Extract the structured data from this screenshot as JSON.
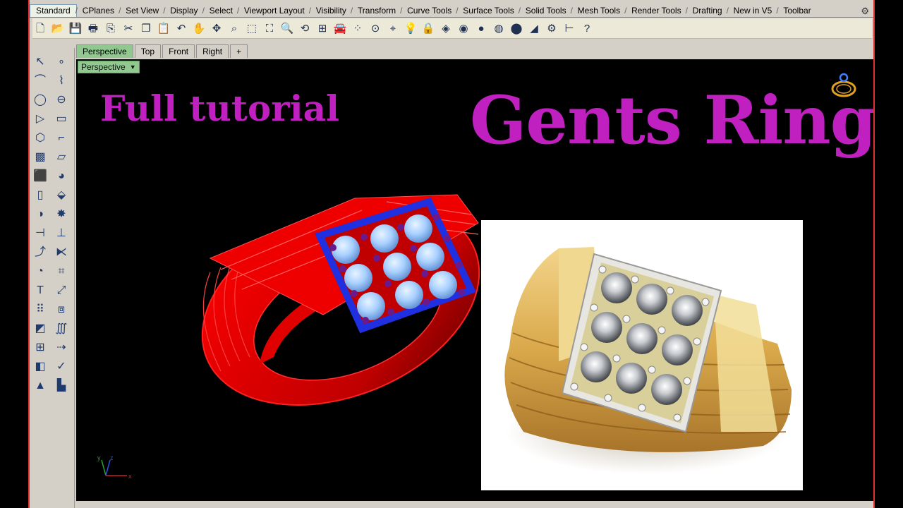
{
  "toolbar_tabs": [
    "Standard",
    "CPlanes",
    "Set View",
    "Display",
    "Select",
    "Viewport Layout",
    "Visibility",
    "Transform",
    "Curve Tools",
    "Surface Tools",
    "Solid Tools",
    "Mesh Tools",
    "Render Tools",
    "Drafting",
    "New in V5",
    "Toolbar"
  ],
  "active_toolbar_tab": "Standard",
  "settings_glyph": "⚙",
  "toolbar_icons": [
    {
      "name": "new-icon",
      "glyph": "🗋"
    },
    {
      "name": "open-icon",
      "glyph": "📂"
    },
    {
      "name": "save-icon",
      "glyph": "💾"
    },
    {
      "name": "print-icon",
      "glyph": "🖶"
    },
    {
      "name": "import-icon",
      "glyph": "⎘"
    },
    {
      "name": "cut-icon",
      "glyph": "✂"
    },
    {
      "name": "copy-icon",
      "glyph": "❐"
    },
    {
      "name": "paste-icon",
      "glyph": "📋"
    },
    {
      "name": "undo-icon",
      "glyph": "↶"
    },
    {
      "name": "pan-icon",
      "glyph": "✋"
    },
    {
      "name": "rotate-view-icon",
      "glyph": "✥"
    },
    {
      "name": "zoom-icon",
      "glyph": "⌕"
    },
    {
      "name": "zoom-window-icon",
      "glyph": "⬚"
    },
    {
      "name": "zoom-extents-icon",
      "glyph": "⛶"
    },
    {
      "name": "zoom-selected-icon",
      "glyph": "🔍"
    },
    {
      "name": "undo-view-icon",
      "glyph": "⟲"
    },
    {
      "name": "four-viewports-icon",
      "glyph": "⊞"
    },
    {
      "name": "car-icon",
      "glyph": "🚘"
    },
    {
      "name": "pointcloud-icon",
      "glyph": "⁘"
    },
    {
      "name": "grid-snap-icon",
      "glyph": "⊙"
    },
    {
      "name": "osnap-icon",
      "glyph": "⌖"
    },
    {
      "name": "light-icon",
      "glyph": "💡"
    },
    {
      "name": "lock-icon",
      "glyph": "🔒"
    },
    {
      "name": "layer-icon",
      "glyph": "◈"
    },
    {
      "name": "color-wheel-icon",
      "glyph": "◉"
    },
    {
      "name": "shaded-sphere-icon",
      "glyph": "●"
    },
    {
      "name": "render-sphere-icon",
      "glyph": "◍"
    },
    {
      "name": "render-blue-icon",
      "glyph": "⬤"
    },
    {
      "name": "spotlight-icon",
      "glyph": "◢"
    },
    {
      "name": "options-gear-icon",
      "glyph": "⚙"
    },
    {
      "name": "dimension-icon",
      "glyph": "⊢"
    },
    {
      "name": "help-icon",
      "glyph": "?"
    }
  ],
  "left_tools": [
    "select-arrow-icon",
    "point-icon",
    "polyline-icon",
    "curve-icon",
    "circle-icon",
    "ellipse-icon",
    "arc-icon",
    "rectangle-icon",
    "polygon-icon",
    "fillet-icon",
    "surface-icon",
    "patch-icon",
    "box-icon",
    "sphere-icon",
    "cylinder-icon",
    "extrude-icon",
    "boolean-icon",
    "explode-icon",
    "trim-icon",
    "split-icon",
    "join-icon",
    "mirror-icon",
    "offset-icon",
    "blend-icon",
    "text-icon",
    "move-icon",
    "array-icon",
    "scale-icon",
    "solid-edit-icon",
    "dimension-tool-icon",
    "grid-array-icon",
    "flow-icon",
    "cage-icon",
    "check-icon",
    "mesh-icon",
    "render-tool-icon"
  ],
  "left_glyphs": [
    "↖",
    "∘",
    "⌒",
    "⌇",
    "◯",
    "⊖",
    "▷",
    "▭",
    "⬡",
    "⌐",
    "▩",
    "▱",
    "⬛",
    "◕",
    "▯",
    "⬙",
    "◑",
    "✸",
    "⊣",
    "⊥",
    "⤴",
    "⧔",
    "◔",
    "⌗",
    "T",
    "⤢",
    "⠿",
    "⧈",
    "◩",
    "∭",
    "⊞",
    "⇢",
    "◧",
    "✓",
    "▲",
    "▙"
  ],
  "viewport_tabs": [
    "Perspective",
    "Top",
    "Front",
    "Right"
  ],
  "active_viewport_tab": "Perspective",
  "add_viewport_glyph": "+",
  "viewport_label": "Perspective",
  "viewport_label_arrow": "▼",
  "overlay": {
    "subtitle": "Full tutorial",
    "title": "Gents Ring"
  },
  "colors": {
    "title": "#c020c0",
    "ring_red": "#ff0000",
    "bezel_blue": "#2030e0",
    "gem_light": "#a8d4ff",
    "prong_purple": "#6a1a8a",
    "gold": "#d9a84a",
    "accent_border": "#e03030"
  },
  "axis_labels": {
    "x": "x",
    "y": "y",
    "z": "z"
  }
}
